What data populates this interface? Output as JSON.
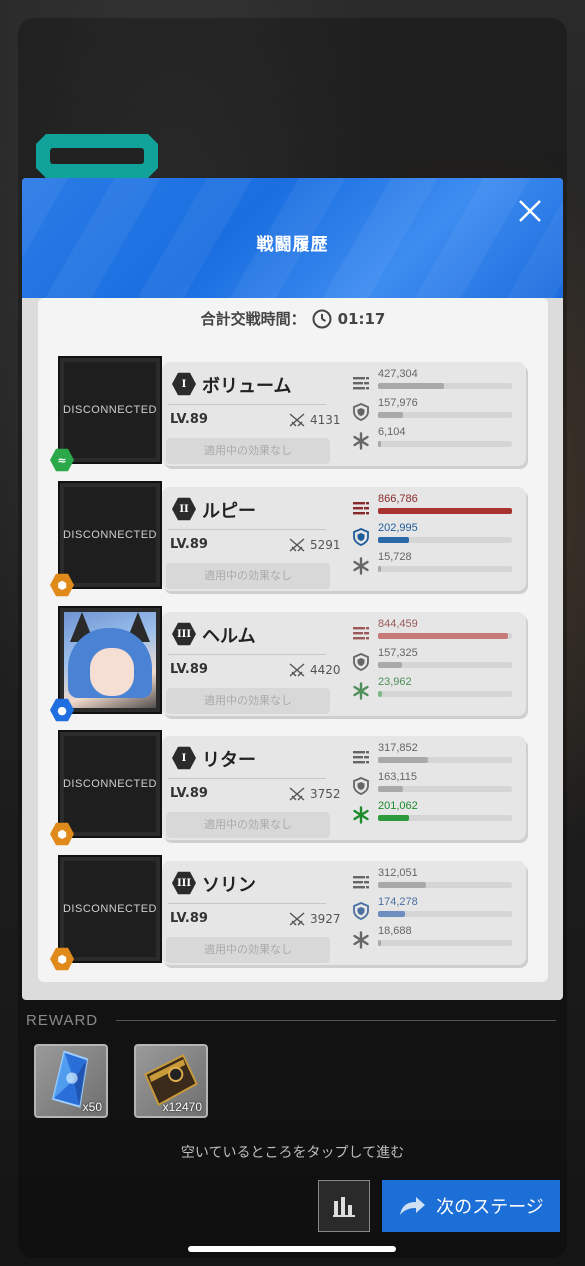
{
  "modal": {
    "title": "戦闘履歴",
    "total_time_label": "合計交戦時間：",
    "total_time": "01:17"
  },
  "characters": [
    {
      "name": "ボリューム",
      "class": "I",
      "level": "LV.89",
      "power": "4131",
      "effect": "適用中の効果なし",
      "disconnected": "DISCONNECTED",
      "element": "wind",
      "stats": [
        {
          "type": "damage",
          "value": "427,304",
          "ratio": 0.49,
          "highlight": false
        },
        {
          "type": "defense",
          "value": "157,976",
          "ratio": 0.19,
          "highlight": false
        },
        {
          "type": "heal",
          "value": "6,104",
          "ratio": 0.02,
          "highlight": false
        }
      ]
    },
    {
      "name": "ルピー",
      "class": "II",
      "level": "LV.89",
      "power": "5291",
      "effect": "適用中の効果なし",
      "disconnected": "DISCONNECTED",
      "element": "iron",
      "stats": [
        {
          "type": "damage",
          "value": "866,786",
          "ratio": 1.0,
          "highlight": true
        },
        {
          "type": "defense",
          "value": "202,995",
          "ratio": 0.23,
          "highlight": true
        },
        {
          "type": "heal",
          "value": "15,728",
          "ratio": 0.02,
          "highlight": false
        }
      ]
    },
    {
      "name": "ヘルム",
      "class": "III",
      "level": "LV.89",
      "power": "4420",
      "effect": "適用中の効果なし",
      "disconnected": "",
      "element": "water",
      "stats": [
        {
          "type": "damage",
          "value": "844,459",
          "ratio": 0.97,
          "highlight": "light"
        },
        {
          "type": "defense",
          "value": "157,325",
          "ratio": 0.18,
          "highlight": false
        },
        {
          "type": "heal",
          "value": "23,962",
          "ratio": 0.03,
          "highlight": "light"
        }
      ]
    },
    {
      "name": "リター",
      "class": "I",
      "level": "LV.89",
      "power": "3752",
      "effect": "適用中の効果なし",
      "disconnected": "DISCONNECTED",
      "element": "iron",
      "stats": [
        {
          "type": "damage",
          "value": "317,852",
          "ratio": 0.37,
          "highlight": false
        },
        {
          "type": "defense",
          "value": "163,115",
          "ratio": 0.19,
          "highlight": false
        },
        {
          "type": "heal",
          "value": "201,062",
          "ratio": 0.23,
          "highlight": true
        }
      ]
    },
    {
      "name": "ソリン",
      "class": "III",
      "level": "LV.89",
      "power": "3927",
      "effect": "適用中の効果なし",
      "disconnected": "DISCONNECTED",
      "element": "iron",
      "stats": [
        {
          "type": "damage",
          "value": "312,051",
          "ratio": 0.36,
          "highlight": false
        },
        {
          "type": "defense",
          "value": "174,278",
          "ratio": 0.2,
          "highlight": "light"
        },
        {
          "type": "heal",
          "value": "18,688",
          "ratio": 0.02,
          "highlight": false
        }
      ]
    }
  ],
  "reward": {
    "label": "REWARD",
    "items": [
      {
        "icon": "blue-crystal-icon",
        "count": "x50"
      },
      {
        "icon": "credit-case-icon",
        "count": "x12470"
      }
    ]
  },
  "footer": {
    "tap_hint": "空いているところをタップして進む",
    "next_label": "次のステージ"
  },
  "colors": {
    "damage_hi": "#a83232",
    "damage_light": "#c77a7a",
    "defense_hi": "#2a6aa8",
    "defense_light": "#6c8fbf",
    "heal_hi": "#2d9a3c",
    "heal_light": "#7cb987",
    "neutral": "#a9a9a9",
    "accent": "#1c6fd6"
  }
}
